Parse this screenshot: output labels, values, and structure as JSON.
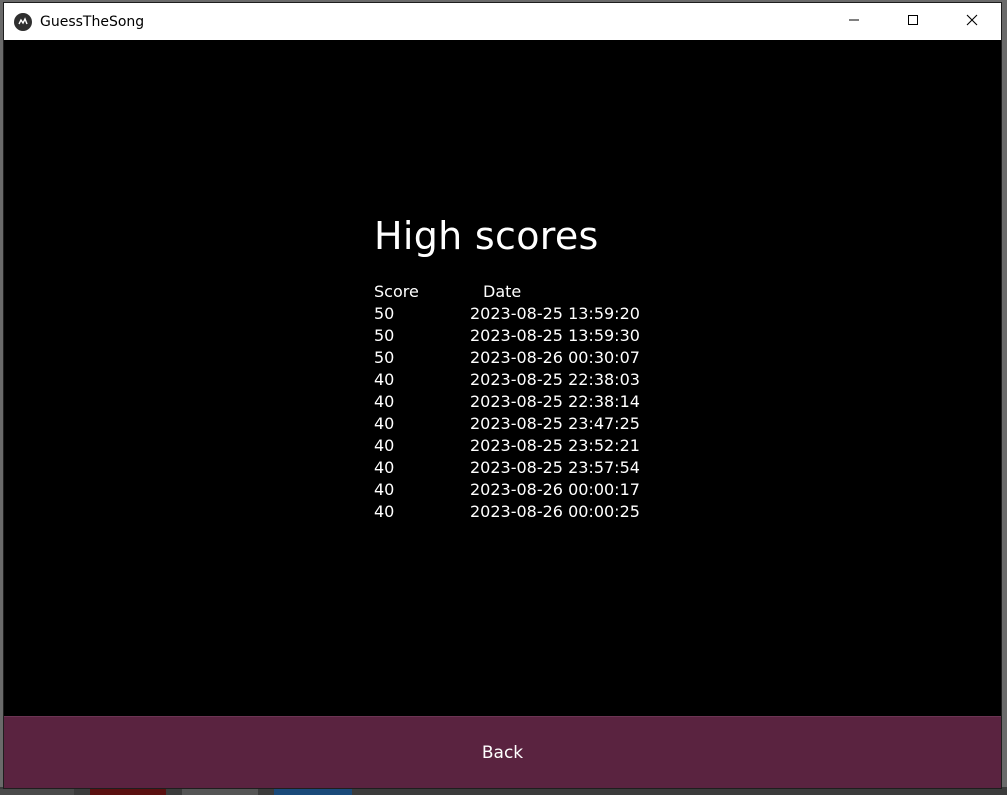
{
  "window": {
    "title": "GuessTheSong"
  },
  "content": {
    "heading": "High scores",
    "columns": {
      "score": "Score",
      "date": "Date"
    },
    "rows": [
      {
        "score": "50",
        "date": "2023-08-25 13:59:20"
      },
      {
        "score": "50",
        "date": "2023-08-25 13:59:30"
      },
      {
        "score": "50",
        "date": "2023-08-26 00:30:07"
      },
      {
        "score": "40",
        "date": "2023-08-25 22:38:03"
      },
      {
        "score": "40",
        "date": "2023-08-25 22:38:14"
      },
      {
        "score": "40",
        "date": "2023-08-25 23:47:25"
      },
      {
        "score": "40",
        "date": "2023-08-25 23:52:21"
      },
      {
        "score": "40",
        "date": "2023-08-25 23:57:54"
      },
      {
        "score": "40",
        "date": "2023-08-26 00:00:17"
      },
      {
        "score": "40",
        "date": "2023-08-26 00:00:25"
      }
    ]
  },
  "footer": {
    "back_label": "Back"
  },
  "colors": {
    "background": "#000000",
    "text": "#ffffff",
    "button": "#5a2340",
    "titlebar": "#ffffff"
  },
  "icons": {
    "app": "app-logo-icon",
    "minimize": "minimize-icon",
    "maximize": "maximize-icon",
    "close": "close-icon"
  }
}
